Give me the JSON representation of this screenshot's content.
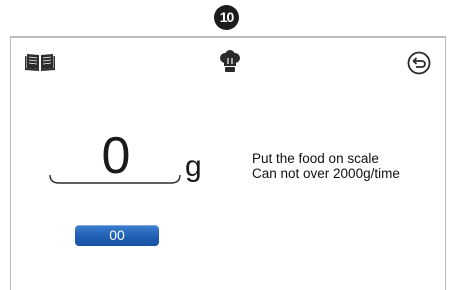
{
  "step": {
    "number": "10"
  },
  "toolbar": {
    "left_icon": "recipe-book-icon",
    "center_icon": "chef-hat-icon",
    "right_icon": "back-icon"
  },
  "scale": {
    "weight_value": "0",
    "unit": "g"
  },
  "instructions": {
    "line1": "Put the food on scale",
    "line2": "Can not over 2000g/time"
  },
  "count_button": {
    "label": "00"
  },
  "colors": {
    "button": "#1f5fb3",
    "border": "#bdbdbd",
    "icon": "#2b2b2b"
  }
}
